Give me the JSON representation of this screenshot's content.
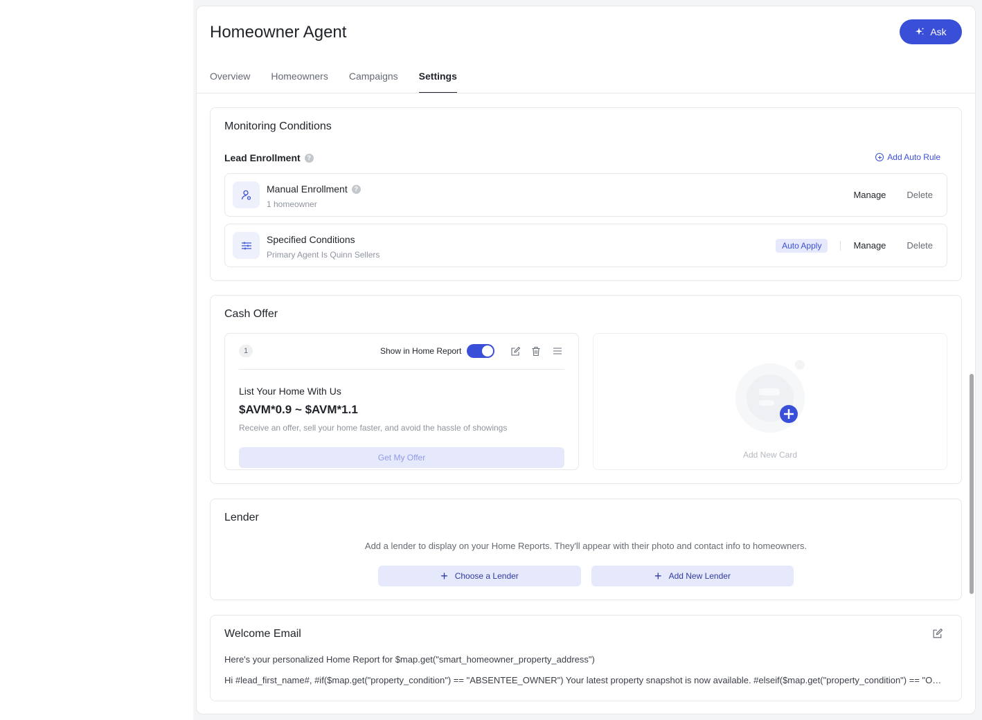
{
  "header": {
    "title": "Homeowner Agent",
    "ask_label": "Ask"
  },
  "tabs": [
    {
      "label": "Overview",
      "active": false
    },
    {
      "label": "Homeowners",
      "active": false
    },
    {
      "label": "Campaigns",
      "active": false
    },
    {
      "label": "Settings",
      "active": true
    }
  ],
  "monitoring": {
    "title": "Monitoring Conditions",
    "lead_enrollment_label": "Lead Enrollment",
    "add_rule_label": "Add Auto Rule",
    "rules": [
      {
        "name": "Manual Enrollment",
        "sub": "1 homeowner",
        "manage": "Manage",
        "delete": "Delete"
      },
      {
        "name": "Specified Conditions",
        "sub": "Primary Agent Is Quinn Sellers",
        "badge": "Auto Apply",
        "manage": "Manage",
        "delete": "Delete"
      }
    ]
  },
  "cash_offer": {
    "title": "Cash Offer",
    "card": {
      "number": "1",
      "show_label": "Show in Home Report",
      "show_enabled": true,
      "heading": "List Your Home With Us",
      "price": "$AVM*0.9 ~ $AVM*1.1",
      "description": "Receive an offer, sell your home faster, and avoid the hassle of showings",
      "button": "Get My Offer"
    },
    "add_card_label": "Add New Card"
  },
  "lender": {
    "title": "Lender",
    "description": "Add a lender to display on your Home Reports. They'll appear with their photo and contact info to homeowners.",
    "choose_label": "Choose a Lender",
    "add_label": "Add New Lender"
  },
  "welcome_email": {
    "title": "Welcome Email",
    "subject": "Here's your personalized Home Report for $map.get(\"smart_homeowner_property_address\")",
    "body": "Hi #lead_first_name#, #if($map.get(\"property_condition\") == \"ABSENTEE_OWNER\") Your latest property snapshot is now available. #elseif($map.get(\"property_condition\") == \"OWNER_OCCUPIED\")"
  },
  "colors": {
    "accent": "#3a4fd8",
    "accent_light": "#e6e9fb"
  }
}
